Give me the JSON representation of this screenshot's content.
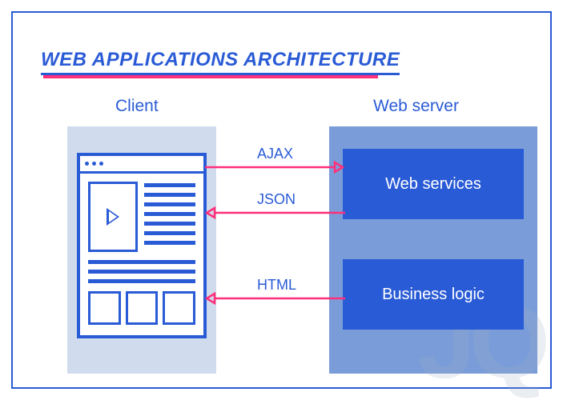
{
  "title": "WEB APPLICATIONS ARCHITECTURE",
  "client_label": "Client",
  "server_label": "Web server",
  "server_boxes": {
    "web_services": "Web services",
    "business_logic": "Business logic"
  },
  "connections": {
    "ajax": "AJAX",
    "json": "JSON",
    "html": "HTML"
  },
  "colors": {
    "primary": "#2a5bd6",
    "accent": "#ff2f7a",
    "client_bg": "#d0dced",
    "server_bg": "#7a9dd9"
  },
  "watermark": "JQ"
}
